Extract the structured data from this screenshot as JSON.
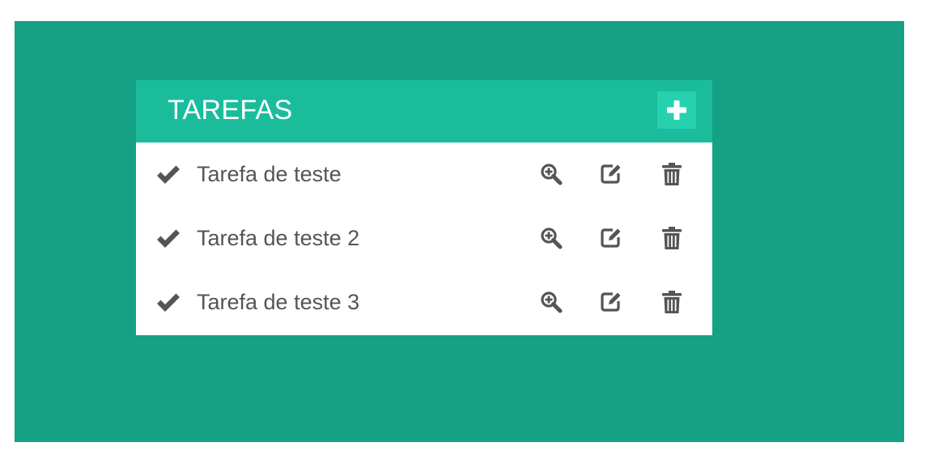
{
  "panel": {
    "title": "TAREFAS",
    "add_icon": "plus-icon"
  },
  "tasks": [
    {
      "label": "Tarefa de teste"
    },
    {
      "label": "Tarefa de teste 2"
    },
    {
      "label": "Tarefa de teste 3"
    }
  ],
  "icons": {
    "check": "check-icon",
    "view": "zoom-in-icon",
    "edit": "edit-icon",
    "delete": "trash-icon"
  },
  "colors": {
    "background": "#16a085",
    "header": "#1abc9c",
    "add_button": "#27d1b0",
    "text": "#555555"
  }
}
